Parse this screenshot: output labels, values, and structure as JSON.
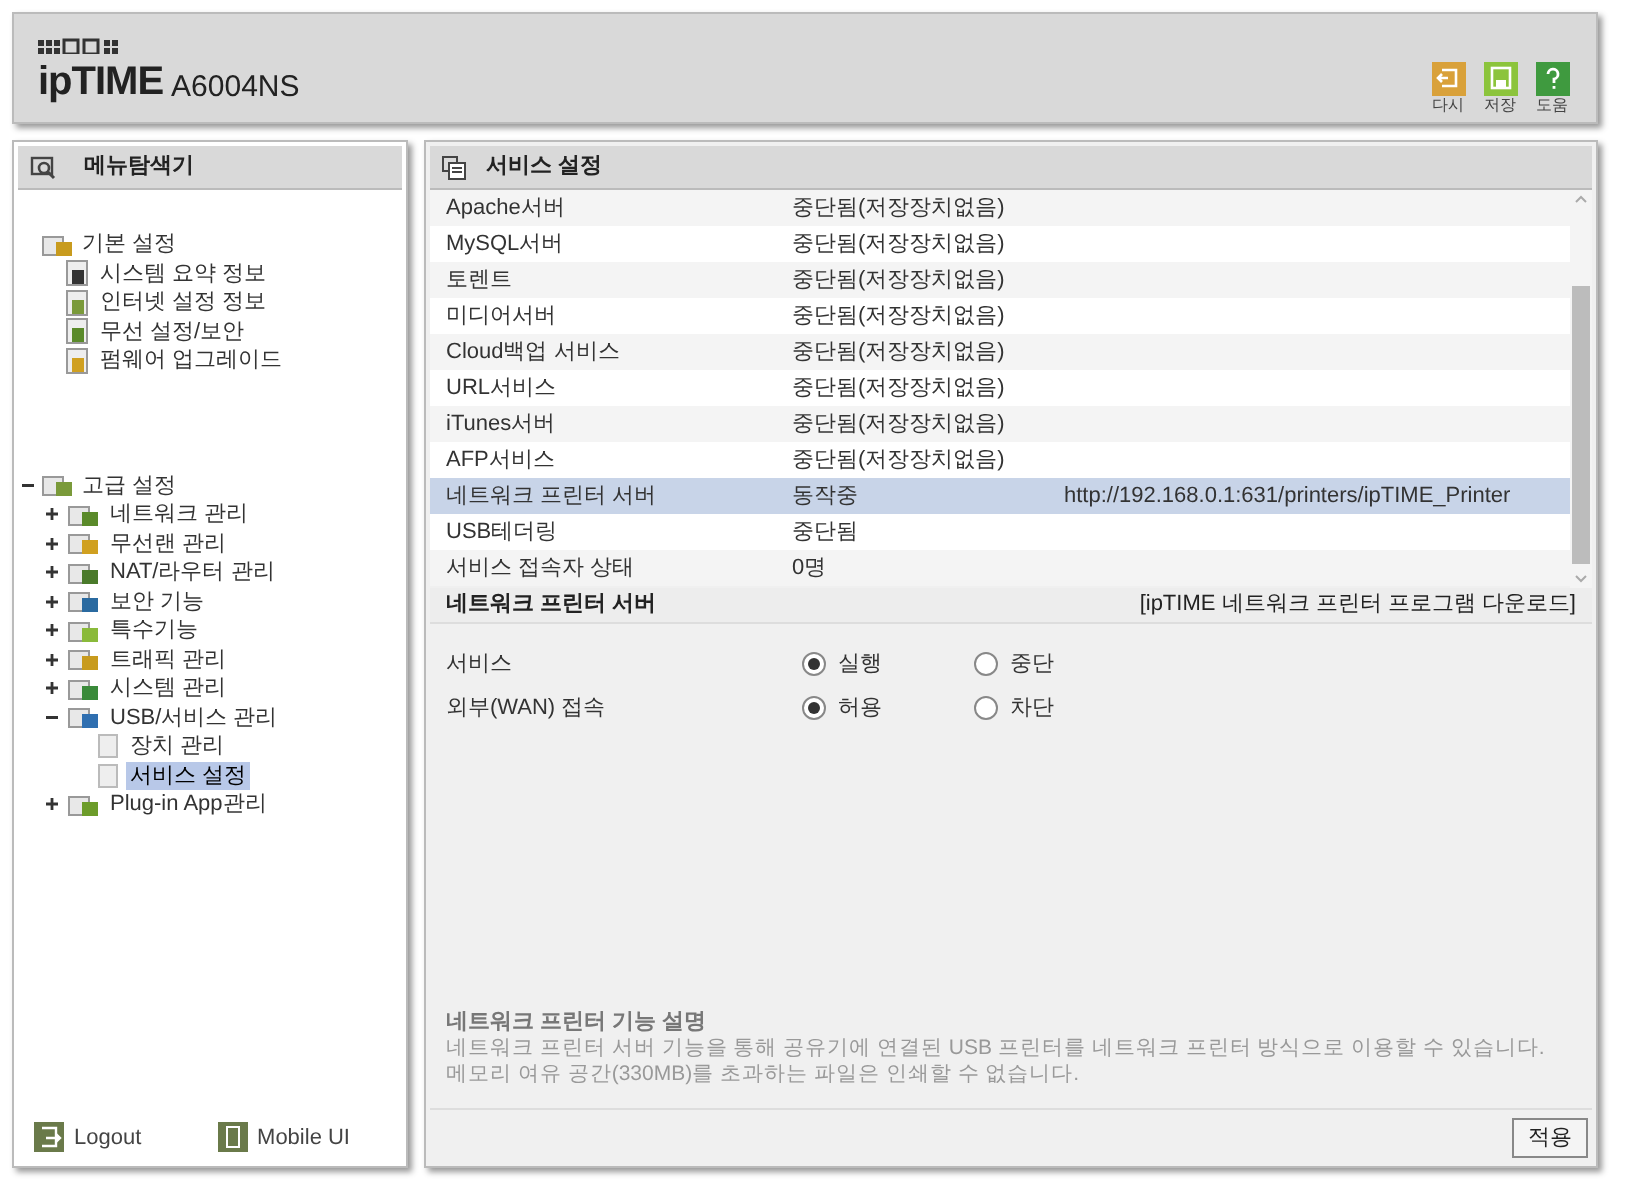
{
  "header": {
    "logo_wordmark": "ipTIME",
    "model": "A6004NS",
    "actions": [
      {
        "label": "다시"
      },
      {
        "label": "저장"
      },
      {
        "label": "도움"
      }
    ]
  },
  "sidebar": {
    "title": "메뉴탐색기",
    "groups": [
      {
        "label": "기본 설정",
        "selected": false,
        "children": [
          {
            "label": "시스템 요약 정보",
            "selected": false
          },
          {
            "label": "인터넷 설정 정보",
            "selected": false
          },
          {
            "label": "무선 설정/보안",
            "selected": false
          },
          {
            "label": "펌웨어 업그레이드",
            "selected": false
          }
        ]
      },
      {
        "label": "고급 설정",
        "selected": false,
        "expanded": true,
        "children": [
          {
            "label": "네트워크 관리",
            "selected": false,
            "expanded": false
          },
          {
            "label": "무선랜 관리",
            "selected": false,
            "expanded": false
          },
          {
            "label": "NAT/라우터 관리",
            "selected": false,
            "expanded": false
          },
          {
            "label": "보안 기능",
            "selected": false,
            "expanded": false
          },
          {
            "label": "특수기능",
            "selected": false,
            "expanded": false
          },
          {
            "label": "트래픽 관리",
            "selected": false,
            "expanded": false
          },
          {
            "label": "시스템 관리",
            "selected": false,
            "expanded": false
          },
          {
            "label": "USB/서비스 관리",
            "selected": false,
            "expanded": true,
            "children": [
              {
                "label": "장치 관리",
                "selected": false
              },
              {
                "label": "서비스 설정",
                "selected": true
              }
            ]
          },
          {
            "label": "Plug-in App관리",
            "selected": false,
            "expanded": false
          }
        ]
      }
    ],
    "footer": [
      {
        "label": "Logout"
      },
      {
        "label": "Mobile UI"
      }
    ]
  },
  "main": {
    "title": "서비스 설정",
    "services": [
      {
        "name": "Apache서버",
        "status": "중단됨(저장장치없음)",
        "selected": false
      },
      {
        "name": "MySQL서버",
        "status": "중단됨(저장장치없음)",
        "selected": false
      },
      {
        "name": "토렌트",
        "status": "중단됨(저장장치없음)",
        "selected": false
      },
      {
        "name": "미디어서버",
        "status": "중단됨(저장장치없음)",
        "selected": false
      },
      {
        "name": "Cloud백업 서비스",
        "status": "중단됨(저장장치없음)",
        "selected": false
      },
      {
        "name": "URL서비스",
        "status": "중단됨(저장장치없음)",
        "selected": false
      },
      {
        "name": "iTunes서버",
        "status": "중단됨(저장장치없음)",
        "selected": false
      },
      {
        "name": "AFP서비스",
        "status": "중단됨(저장장치없음)",
        "selected": false
      },
      {
        "name": "네트워크 프린터 서버",
        "status": "동작중",
        "url": "http://192.168.0.1:631/printers/ipTIME_Printer",
        "selected": true
      },
      {
        "name": "USB테더링",
        "status": "중단됨",
        "selected": false
      },
      {
        "name": "서비스 접속자 상태",
        "status": "0명",
        "selected": false
      }
    ],
    "section": {
      "title": "네트워크 프린터 서버",
      "download_link": "[ipTIME 네트워크 프린터 프로그램 다운로드]",
      "settings": [
        {
          "label": "서비스",
          "options": [
            {
              "label": "실행",
              "selected": true
            },
            {
              "label": "중단",
              "selected": false
            }
          ]
        },
        {
          "label": "외부(WAN) 접속",
          "options": [
            {
              "label": "허용",
              "selected": true
            },
            {
              "label": "차단",
              "selected": false
            }
          ]
        }
      ]
    },
    "description": {
      "title": "네트워크 프린터 기능 설명",
      "lines": [
        "네트워크 프린터 서버 기능을 통해 공유기에 연결된 USB 프린터를 네트워크 프린터 방식으로 이용할 수 있습니다.",
        "메모리 여유 공간(330MB)를 초과하는 파일은 인쇄할 수 없습니다."
      ]
    },
    "apply_button": "적용"
  }
}
